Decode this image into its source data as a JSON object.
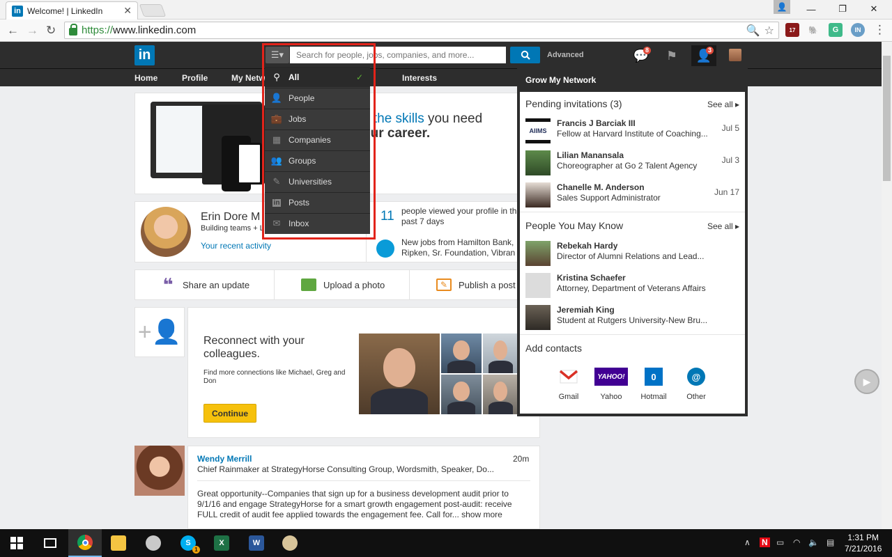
{
  "browser": {
    "tab_title": "Welcome! | LinkedIn",
    "tab_favicon": "in",
    "url_scheme": "https://",
    "url_host": "www.linkedin.com",
    "extension_badge": "17",
    "extension_label": "IN"
  },
  "header": {
    "logo": "in",
    "search_placeholder": "Search for people, jobs, companies, and more...",
    "advanced_label": "Advanced",
    "messages_badge": "8",
    "connections_badge": "3"
  },
  "subnav": {
    "items": [
      "Home",
      "Profile",
      "My Netw",
      "Interests"
    ]
  },
  "search_dropdown": {
    "items": [
      {
        "label": "All",
        "icon": "search-icon",
        "selected": true
      },
      {
        "label": "People",
        "icon": "person-icon"
      },
      {
        "label": "Jobs",
        "icon": "briefcase-icon"
      },
      {
        "label": "Companies",
        "icon": "building-icon"
      },
      {
        "label": "Groups",
        "icon": "group-icon"
      },
      {
        "label": "Universities",
        "icon": "graduation-icon"
      },
      {
        "label": "Posts",
        "icon": "linkedin-icon"
      },
      {
        "label": "Inbox",
        "icon": "envelope-icon"
      }
    ]
  },
  "promo": {
    "line1_highlight": "n the skills",
    "line1_rest": " you need",
    "line2": "our career."
  },
  "profile": {
    "name": "Erin Dore M",
    "headline": "Building teams + L",
    "recent_activity": "Your recent activity",
    "views_count": "11",
    "views_text": "people viewed your profile in th past 7 days",
    "jobs_text_1": "New jobs from Hamilton Bank,",
    "jobs_text_2": "Ripken, Sr. Foundation, Vibran"
  },
  "share_bar": {
    "share_update": "Share an update",
    "upload_photo": "Upload a photo",
    "publish_post": "Publish a post"
  },
  "reconnect": {
    "title": "Reconnect with your colleagues.",
    "subtitle": "Find more connections like Michael, Greg and Don",
    "button": "Continue"
  },
  "post": {
    "author": "Wendy Merrill",
    "time": "20m",
    "headline": "Chief Rainmaker at StrategyHorse Consulting Group, Wordsmith, Speaker, Do...",
    "body": "Great opportunity--Companies that sign up for a business development audit prior to 9/1/16 and engage StrategyHorse for a smart growth engagement post-audit: receive FULL credit of audit fee applied towards the engagement fee. Call for...",
    "show_more": "show more"
  },
  "grow_network": {
    "title": "Grow My Network",
    "pending_title": "Pending invitations (3)",
    "see_all": "See all",
    "invitations": [
      {
        "name": "Francis J Barciak III",
        "subtitle": "Fellow at Harvard Institute of Coaching...",
        "date": "Jul 5",
        "logo": "AIIMS"
      },
      {
        "name": "Lilian Manansala",
        "subtitle": "Choreographer at Go 2 Talent Agency",
        "date": "Jul 3"
      },
      {
        "name": "Chanelle M. Anderson",
        "subtitle": "Sales Support Administrator",
        "date": "Jun 17"
      }
    ],
    "pymk_title": "People You May Know",
    "pymk": [
      {
        "name": "Rebekah Hardy",
        "subtitle": "Director of Alumni Relations and Lead..."
      },
      {
        "name": "Kristina Schaefer",
        "subtitle": "Attorney, Department of Veterans Affairs"
      },
      {
        "name": "Jeremiah King",
        "subtitle": "Student at Rutgers University-New Bru..."
      }
    ],
    "add_contacts_title": "Add contacts",
    "contacts": [
      {
        "label": "Gmail",
        "icon": "gmail-icon"
      },
      {
        "label": "Yahoo",
        "icon": "yahoo-icon",
        "mark": "YAHOO!"
      },
      {
        "label": "Hotmail",
        "icon": "outlook-icon",
        "mark": "0"
      },
      {
        "label": "Other",
        "icon": "at-icon",
        "mark": "@"
      }
    ]
  },
  "taskbar": {
    "time": "1:31 PM",
    "date": "7/21/2016",
    "skype_badge": "1"
  },
  "colors": {
    "linkedin_blue": "#0077b5",
    "header_dark": "#2d2d2d",
    "highlight_red": "#e2231a",
    "continue_yellow": "#f6c10c"
  }
}
